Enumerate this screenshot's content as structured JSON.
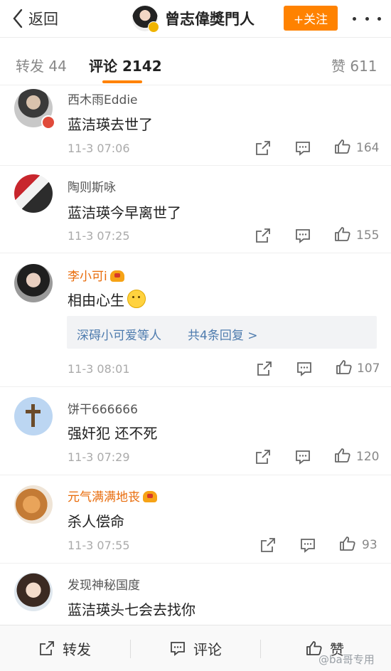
{
  "header": {
    "back_label": "返回",
    "user_name": "曾志偉獎門人",
    "follow_label": "+关注"
  },
  "tabs": {
    "repost": "转发 44",
    "comments": "评论 2142",
    "likes": "赞 611"
  },
  "comments": [
    {
      "user": "西木雨Eddie",
      "text": "蓝洁瑛去世了",
      "time": "11-3 07:06",
      "likes": "164"
    },
    {
      "user": "陶则斯咏",
      "text": "蓝洁瑛今早离世了",
      "time": "11-3 07:25",
      "likes": "155"
    },
    {
      "user": "李小可i",
      "text": "相由心生",
      "time": "11-3 08:01",
      "likes": "107",
      "reply_users": "深碍小可爱等人",
      "reply_count": "共4条回复 >"
    },
    {
      "user": "饼干666666",
      "text": "强奸犯 还不死",
      "time": "11-3 07:29",
      "likes": "120"
    },
    {
      "user": "元气满满地丧",
      "text": "杀人偿命",
      "time": "11-3 07:55",
      "likes": "93"
    },
    {
      "user": "发现神秘国度",
      "text": "蓝洁瑛头七会去找你"
    }
  ],
  "bottombar": {
    "repost": "转发",
    "comment": "评论",
    "like": "赞"
  },
  "watermark": "@ba哥专用",
  "colors": {
    "accent": "#ff8200",
    "link": "#4f7cae",
    "vip_name": "#e86b0a"
  }
}
